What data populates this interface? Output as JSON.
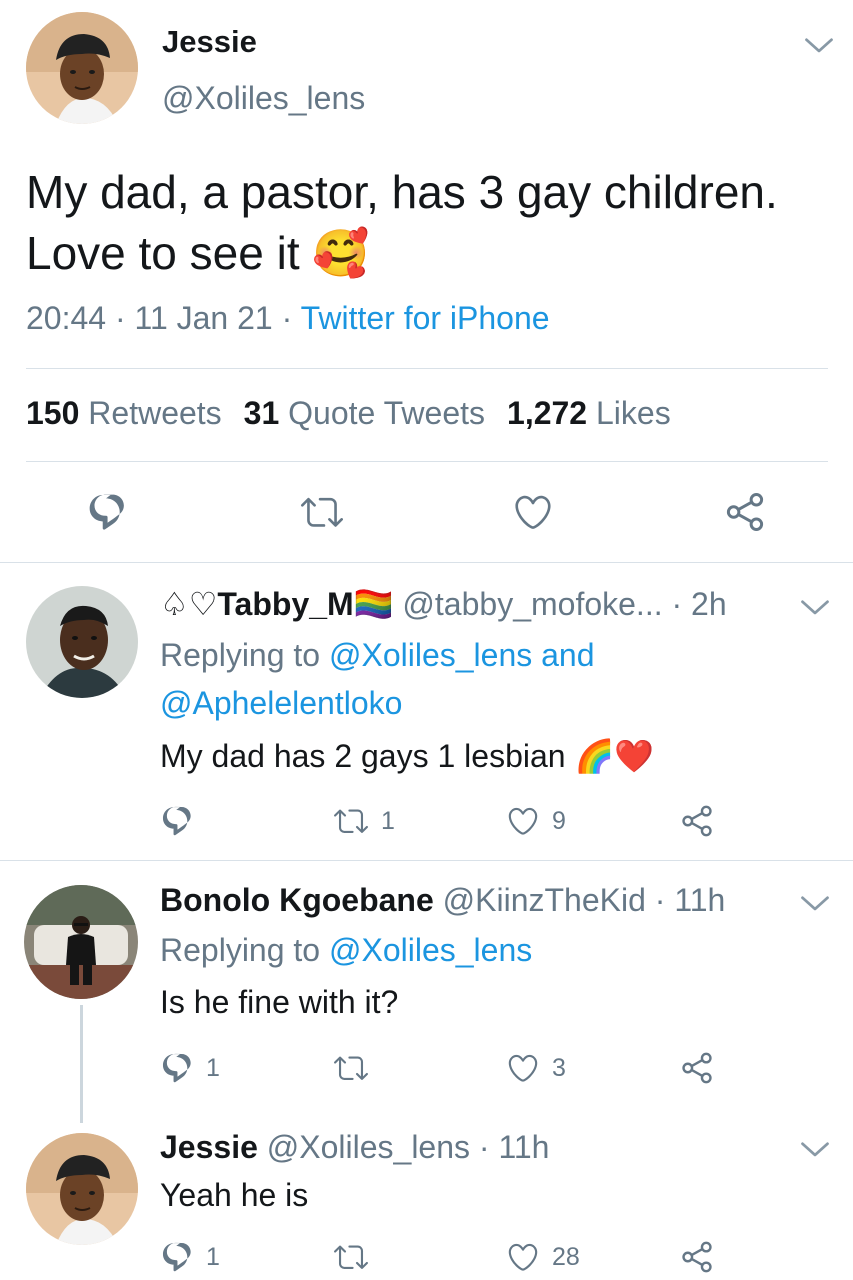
{
  "main_tweet": {
    "name": "Jessie",
    "handle": "@Xoliles_lens",
    "text": "My dad, a pastor, has 3 gay children. Love to see it",
    "emoji": "🥰",
    "time": "20:44",
    "date": "11 Jan 21",
    "separator": " · ",
    "source": "Twitter for iPhone",
    "stats": {
      "retweets_count": "150",
      "retweets_label": "Retweets",
      "quotes_count": "31",
      "quotes_label": "Quote Tweets",
      "likes_count": "1,272",
      "likes_label": "Likes"
    }
  },
  "replies": [
    {
      "name": "♤♡Tabby_M",
      "name_emoji": "🏳️‍🌈",
      "handle": "@tabby_mofoke...",
      "time": "· 2h",
      "replying_prefix": "Replying to",
      "replying_to_1": "@Xoliles_lens and",
      "replying_to_2": "@Aphelelentloko",
      "text": "My dad has 2 gays 1 lesbian",
      "text_emoji": "🌈❤️",
      "reply_count": "",
      "retweet_count": "1",
      "like_count": "9"
    },
    {
      "name": "Bonolo Kgoebane",
      "handle": "@KiinzTheKid",
      "time": "· 11h",
      "replying_prefix": "Replying to",
      "replying_to_1": "@Xoliles_lens",
      "text": "Is he fine with it?",
      "reply_count": "1",
      "retweet_count": "",
      "like_count": "3"
    },
    {
      "name": "Jessie",
      "handle": "@Xoliles_lens",
      "time": "· 11h",
      "text": "Yeah he is",
      "reply_count": "1",
      "retweet_count": "",
      "like_count": "28"
    }
  ],
  "icons": {
    "reply": "reply-icon",
    "retweet": "retweet-icon",
    "like": "heart-icon",
    "share": "share-icon",
    "more": "chevron-down-icon"
  },
  "colors": {
    "link": "#1b95e0",
    "secondary_text": "#657786",
    "divider": "#d9e1e8"
  }
}
